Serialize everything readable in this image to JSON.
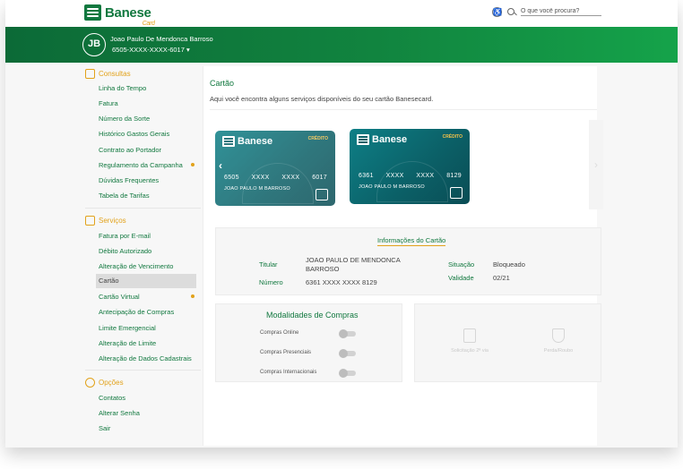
{
  "header": {
    "logo_text": "Banese",
    "logo_sub": "Card",
    "search_placeholder": "O que você procura?"
  },
  "user": {
    "initials": "JB",
    "name": "Joao Paulo De Mendonca Barroso",
    "card_masked": "6505-XXXX-XXXX-6017 ▾"
  },
  "sidebar": {
    "consultas": {
      "title": "Consultas",
      "items": [
        "Linha do Tempo",
        "Fatura",
        "Número da Sorte",
        "Histórico Gastos Gerais",
        "Contrato ao Portador",
        "Regulamento da Campanha",
        "Dúvidas Frequentes",
        "Tabela de Tarifas"
      ]
    },
    "servicos": {
      "title": "Serviços",
      "items": [
        "Fatura por E-mail",
        "Débito Autorizado",
        "Alteração de Vencimento",
        "Cartão",
        "Cartão Virtual",
        "Antecipação de Compras",
        "Limite Emergencial",
        "Alteração de Limite",
        "Alteração de Dados Cadastrais"
      ]
    },
    "opcoes": {
      "title": "Opções",
      "items": [
        "Contatos",
        "Alterar Senha",
        "Sair"
      ]
    }
  },
  "main": {
    "title": "Cartão",
    "description": "Aqui você encontra alguns serviços disponíveis do seu cartão Banesecard."
  },
  "cards": [
    {
      "brand": "Banese",
      "type": "CRÉDITO",
      "number": [
        "6505",
        "XXXX",
        "XXXX",
        "6017"
      ],
      "holder": "JOAO  PAULO  M  BARROSO"
    },
    {
      "brand": "Banese",
      "type": "CRÉDITO",
      "number": [
        "6361",
        "XXXX",
        "XXXX",
        "8129"
      ],
      "holder": "JOAO  PAULO  M  BARROSO"
    }
  ],
  "info": {
    "title": "Informações do Cartão",
    "titular_label": "Titular",
    "titular_value": "JOAO PAULO DE MENDONCA BARROSO",
    "numero_label": "Número",
    "numero_value": "6361 XXXX XXXX 8129",
    "situacao_label": "Situação",
    "situacao_value": "Bloqueado",
    "validade_label": "Validade",
    "validade_value": "02/21"
  },
  "modalidades": {
    "title": "Modalidades de Compras",
    "items": [
      "Compras Online",
      "Compras Presenciais",
      "Compras Internacionais"
    ]
  },
  "services": {
    "segunda_via": "Solicitação 2ª via",
    "perda_roubo": "Perda/Roubo"
  },
  "colors": {
    "brand_green": "#11783f",
    "accent": "#e2a21b",
    "card_teal": "#0b6168"
  }
}
